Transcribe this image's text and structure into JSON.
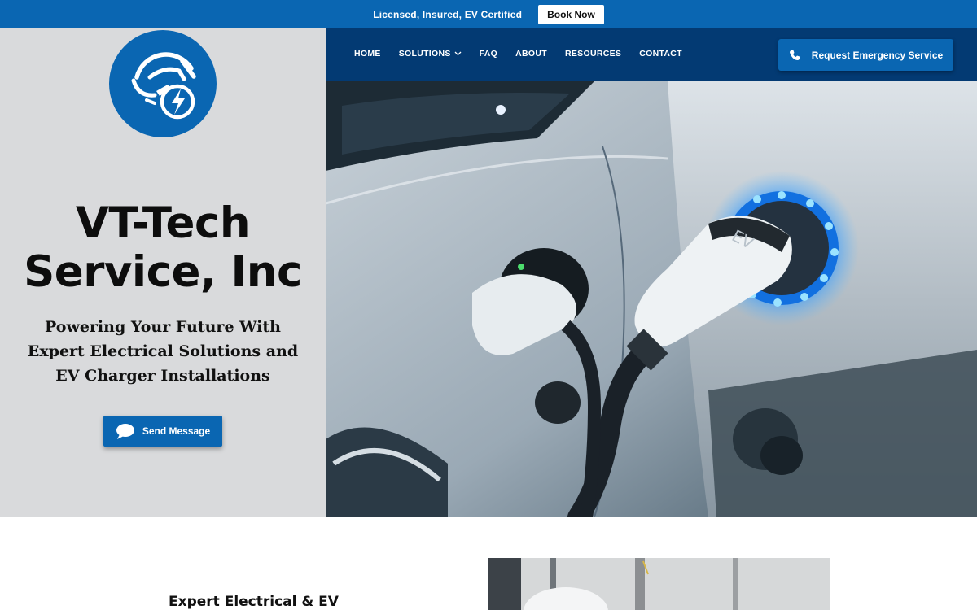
{
  "topbar": {
    "text": "Licensed, Insured, EV Certified",
    "book_button": "Book Now"
  },
  "brand": {
    "logo_icon": "ev-charger-plug-lightning-icon",
    "title_line1": "VT-Tech",
    "title_line2": "Service, Inc",
    "tagline": "Powering Your Future With Expert Electrical Solutions and EV Charger Installations"
  },
  "hero": {
    "send_button": "Send Message",
    "send_icon": "chat-bubble-icon",
    "image_subject": "white car with EV charging plug attached to a charger port with glowing blue ring labeled EV",
    "plug_label": "EV"
  },
  "nav": {
    "items": [
      {
        "label": "HOME"
      },
      {
        "label": "SOLUTIONS",
        "has_dropdown": true
      },
      {
        "label": "FAQ"
      },
      {
        "label": "ABOUT"
      },
      {
        "label": "RESOURCES"
      },
      {
        "label": "CONTACT"
      }
    ],
    "emergency_button": "Request Emergency Service",
    "emergency_icon": "phone-icon"
  },
  "section": {
    "heading": "Expert Electrical & EV"
  },
  "colors": {
    "brand_blue": "#0a66b2",
    "nav_dark_blue": "#033a73",
    "panel_grey": "#d9dadc",
    "text_dark": "#111111"
  }
}
